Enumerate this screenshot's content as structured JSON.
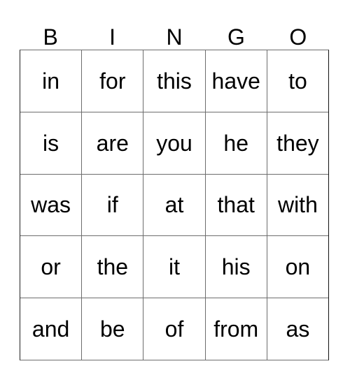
{
  "card": {
    "title": "BINGO",
    "header_letters": [
      "B",
      "I",
      "N",
      "G",
      "O"
    ],
    "grid_rows": [
      {
        "cells": [
          "in",
          "for",
          "this",
          "have",
          "to"
        ]
      },
      {
        "cells": [
          "is",
          "are",
          "you",
          "he",
          "they"
        ]
      },
      {
        "cells": [
          "was",
          "if",
          "at",
          "that",
          "with"
        ]
      },
      {
        "cells": [
          "or",
          "the",
          "it",
          "his",
          "on"
        ]
      },
      {
        "cells": [
          "and",
          "be",
          "of",
          "from",
          "as"
        ]
      }
    ],
    "colors": {
      "text": "#000000",
      "grid_line": "#6d6d6d",
      "background": "#ffffff"
    }
  }
}
